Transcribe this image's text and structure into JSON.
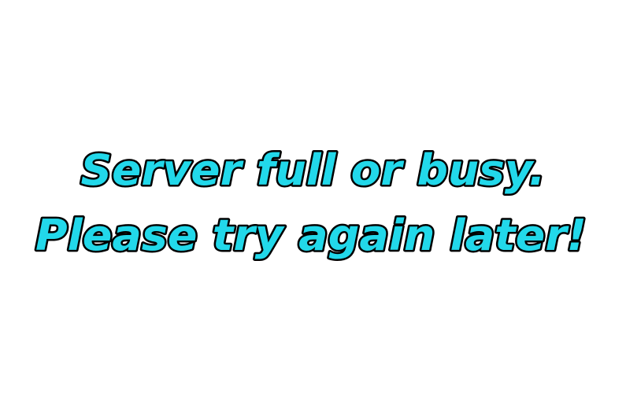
{
  "message": {
    "line1": "Server full or busy.",
    "line2": "Please try again later!"
  },
  "colors": {
    "background": "#ffffff",
    "text_fill": "#22d8ea",
    "text_outline": "#000000"
  }
}
